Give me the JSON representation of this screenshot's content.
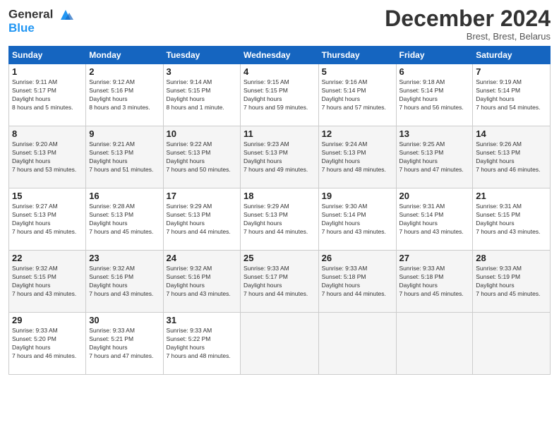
{
  "logo": {
    "line1": "General",
    "line2": "Blue"
  },
  "header": {
    "title": "December 2024",
    "location": "Brest, Brest, Belarus"
  },
  "weekdays": [
    "Sunday",
    "Monday",
    "Tuesday",
    "Wednesday",
    "Thursday",
    "Friday",
    "Saturday"
  ],
  "weeks": [
    [
      {
        "day": "1",
        "sunrise": "9:11 AM",
        "sunset": "5:17 PM",
        "daylight": "8 hours and 5 minutes."
      },
      {
        "day": "2",
        "sunrise": "9:12 AM",
        "sunset": "5:16 PM",
        "daylight": "8 hours and 3 minutes."
      },
      {
        "day": "3",
        "sunrise": "9:14 AM",
        "sunset": "5:15 PM",
        "daylight": "8 hours and 1 minute."
      },
      {
        "day": "4",
        "sunrise": "9:15 AM",
        "sunset": "5:15 PM",
        "daylight": "7 hours and 59 minutes."
      },
      {
        "day": "5",
        "sunrise": "9:16 AM",
        "sunset": "5:14 PM",
        "daylight": "7 hours and 57 minutes."
      },
      {
        "day": "6",
        "sunrise": "9:18 AM",
        "sunset": "5:14 PM",
        "daylight": "7 hours and 56 minutes."
      },
      {
        "day": "7",
        "sunrise": "9:19 AM",
        "sunset": "5:14 PM",
        "daylight": "7 hours and 54 minutes."
      }
    ],
    [
      {
        "day": "8",
        "sunrise": "9:20 AM",
        "sunset": "5:13 PM",
        "daylight": "7 hours and 53 minutes."
      },
      {
        "day": "9",
        "sunrise": "9:21 AM",
        "sunset": "5:13 PM",
        "daylight": "7 hours and 51 minutes."
      },
      {
        "day": "10",
        "sunrise": "9:22 AM",
        "sunset": "5:13 PM",
        "daylight": "7 hours and 50 minutes."
      },
      {
        "day": "11",
        "sunrise": "9:23 AM",
        "sunset": "5:13 PM",
        "daylight": "7 hours and 49 minutes."
      },
      {
        "day": "12",
        "sunrise": "9:24 AM",
        "sunset": "5:13 PM",
        "daylight": "7 hours and 48 minutes."
      },
      {
        "day": "13",
        "sunrise": "9:25 AM",
        "sunset": "5:13 PM",
        "daylight": "7 hours and 47 minutes."
      },
      {
        "day": "14",
        "sunrise": "9:26 AM",
        "sunset": "5:13 PM",
        "daylight": "7 hours and 46 minutes."
      }
    ],
    [
      {
        "day": "15",
        "sunrise": "9:27 AM",
        "sunset": "5:13 PM",
        "daylight": "7 hours and 45 minutes."
      },
      {
        "day": "16",
        "sunrise": "9:28 AM",
        "sunset": "5:13 PM",
        "daylight": "7 hours and 45 minutes."
      },
      {
        "day": "17",
        "sunrise": "9:29 AM",
        "sunset": "5:13 PM",
        "daylight": "7 hours and 44 minutes."
      },
      {
        "day": "18",
        "sunrise": "9:29 AM",
        "sunset": "5:13 PM",
        "daylight": "7 hours and 44 minutes."
      },
      {
        "day": "19",
        "sunrise": "9:30 AM",
        "sunset": "5:14 PM",
        "daylight": "7 hours and 43 minutes."
      },
      {
        "day": "20",
        "sunrise": "9:31 AM",
        "sunset": "5:14 PM",
        "daylight": "7 hours and 43 minutes."
      },
      {
        "day": "21",
        "sunrise": "9:31 AM",
        "sunset": "5:15 PM",
        "daylight": "7 hours and 43 minutes."
      }
    ],
    [
      {
        "day": "22",
        "sunrise": "9:32 AM",
        "sunset": "5:15 PM",
        "daylight": "7 hours and 43 minutes."
      },
      {
        "day": "23",
        "sunrise": "9:32 AM",
        "sunset": "5:16 PM",
        "daylight": "7 hours and 43 minutes."
      },
      {
        "day": "24",
        "sunrise": "9:32 AM",
        "sunset": "5:16 PM",
        "daylight": "7 hours and 43 minutes."
      },
      {
        "day": "25",
        "sunrise": "9:33 AM",
        "sunset": "5:17 PM",
        "daylight": "7 hours and 44 minutes."
      },
      {
        "day": "26",
        "sunrise": "9:33 AM",
        "sunset": "5:18 PM",
        "daylight": "7 hours and 44 minutes."
      },
      {
        "day": "27",
        "sunrise": "9:33 AM",
        "sunset": "5:18 PM",
        "daylight": "7 hours and 45 minutes."
      },
      {
        "day": "28",
        "sunrise": "9:33 AM",
        "sunset": "5:19 PM",
        "daylight": "7 hours and 45 minutes."
      }
    ],
    [
      {
        "day": "29",
        "sunrise": "9:33 AM",
        "sunset": "5:20 PM",
        "daylight": "7 hours and 46 minutes."
      },
      {
        "day": "30",
        "sunrise": "9:33 AM",
        "sunset": "5:21 PM",
        "daylight": "7 hours and 47 minutes."
      },
      {
        "day": "31",
        "sunrise": "9:33 AM",
        "sunset": "5:22 PM",
        "daylight": "7 hours and 48 minutes."
      },
      null,
      null,
      null,
      null
    ]
  ]
}
